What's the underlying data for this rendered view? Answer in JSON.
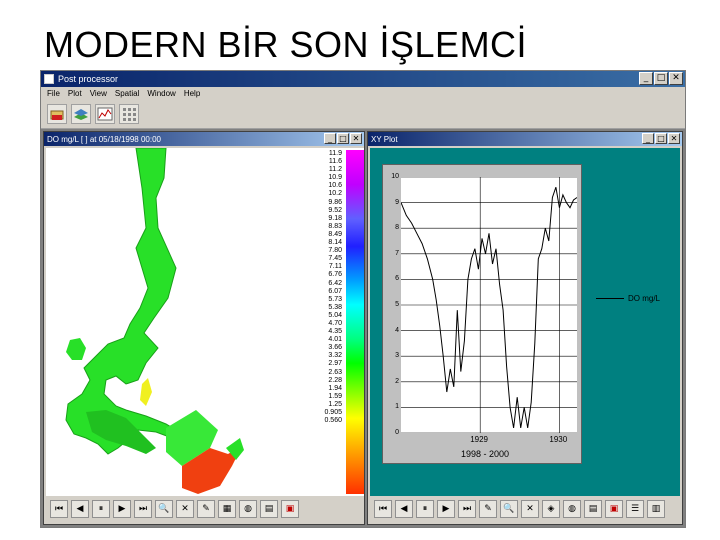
{
  "slide": {
    "title": "MODERN BİR SON İŞLEMCİ"
  },
  "app": {
    "title": "Post processor",
    "menu": [
      "File",
      "Plot",
      "View",
      "Spatial",
      "Window",
      "Help"
    ]
  },
  "map_window": {
    "title": "DO mg/L [    ] at 05/18/1998 00:00",
    "legend_values": [
      "11.9",
      "11.6",
      "11.2",
      "10.9",
      "10.6",
      "10.2",
      "9.86",
      "9.52",
      "9.18",
      "8.83",
      "8.49",
      "8.14",
      "7.80",
      "7.45",
      "7.11",
      "6.76",
      "6.42",
      "6.07",
      "5.73",
      "5.38",
      "5.04",
      "4.70",
      "4.35",
      "4.01",
      "3.66",
      "3.32",
      "2.97",
      "2.63",
      "2.28",
      "1.94",
      "1.59",
      "1.25",
      "0.905",
      "0.560"
    ]
  },
  "plot_window": {
    "title": "XY Plot",
    "series_label": "DO mg/L",
    "x_range_label": "1998 - 2000"
  },
  "chart_data": {
    "type": "line",
    "xlabel": "",
    "ylabel": "",
    "ylim": [
      0,
      10
    ],
    "y_ticks": [
      "10",
      "9",
      "8",
      "7",
      "6",
      "5",
      "4",
      "3",
      "2",
      "1",
      "0"
    ],
    "x_ticks": [
      "1999",
      "1999"
    ],
    "x_tick_labels": [
      "1929",
      "1930"
    ],
    "series": [
      {
        "name": "DO mg/L",
        "x": [
          0,
          0.03,
          0.06,
          0.09,
          0.12,
          0.15,
          0.18,
          0.2,
          0.22,
          0.24,
          0.26,
          0.28,
          0.3,
          0.32,
          0.34,
          0.36,
          0.38,
          0.4,
          0.42,
          0.44,
          0.46,
          0.48,
          0.5,
          0.52,
          0.54,
          0.56,
          0.58,
          0.6,
          0.62,
          0.64,
          0.66,
          0.68,
          0.7,
          0.72,
          0.74,
          0.76,
          0.78,
          0.8,
          0.82,
          0.84,
          0.86,
          0.88,
          0.9,
          0.92,
          0.94,
          0.96,
          0.98,
          1.0
        ],
        "values": [
          9.0,
          8.5,
          8.2,
          7.8,
          7.4,
          6.8,
          6.0,
          5.2,
          4.2,
          3.0,
          1.6,
          2.5,
          1.8,
          4.8,
          2.4,
          3.6,
          6.0,
          6.8,
          7.2,
          6.4,
          7.6,
          7.0,
          7.8,
          6.6,
          7.2,
          5.8,
          4.8,
          2.6,
          1.0,
          0.2,
          1.4,
          0.2,
          1.0,
          0.2,
          1.2,
          3.5,
          6.8,
          7.2,
          8.0,
          7.5,
          9.2,
          9.6,
          8.8,
          9.3,
          9.0,
          8.8,
          9.1,
          9.2
        ]
      }
    ]
  },
  "tools": {
    "map_tools": [
      "first",
      "prev",
      "pause",
      "next",
      "last",
      "zoom-in",
      "zoom-out",
      "pick",
      "color-legend",
      "globe",
      "table",
      "save"
    ],
    "plot_tools": [
      "first",
      "prev",
      "pause",
      "next",
      "last",
      "pick",
      "zoom-in",
      "zoom-out",
      "layers",
      "globe",
      "table",
      "save",
      "list",
      "export"
    ]
  }
}
